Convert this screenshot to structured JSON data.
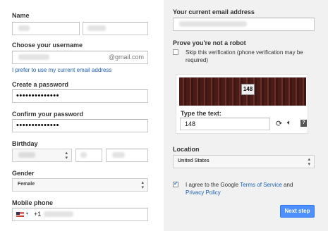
{
  "left": {
    "name_label": "Name",
    "username_label": "Choose your username",
    "username_suffix": "@gmail.com",
    "use_current_email_link": "I prefer to use my current email address",
    "password_label": "Create a password",
    "password_value": "••••••••••••••",
    "confirm_label": "Confirm your password",
    "confirm_value": "••••••••••••••",
    "birthday_label": "Birthday",
    "gender_label": "Gender",
    "gender_value": "Female",
    "mobile_label": "Mobile phone",
    "phone_code": "+1"
  },
  "right": {
    "current_email_label": "Your current email address",
    "robot_label": "Prove you're not a robot",
    "skip_verification_text": "Skip this verification (phone verification may be required)",
    "captcha_number": "148",
    "type_text_label": "Type the text:",
    "captcha_input_value": "148",
    "location_label": "Location",
    "location_value": "United States",
    "terms_prefix": "I agree to the Google ",
    "terms_link": "Terms of Service",
    "terms_and": " and",
    "privacy_link": "Privacy Policy",
    "next_button": "Next step"
  },
  "colors": {
    "accent_button": "#4d90fe",
    "link": "#1a5fb4",
    "panel_bg": "#f1f1f1"
  },
  "icons": {
    "refresh": "refresh-icon",
    "audio": "speaker-icon",
    "help": "help-icon",
    "flag": "us-flag-icon"
  }
}
